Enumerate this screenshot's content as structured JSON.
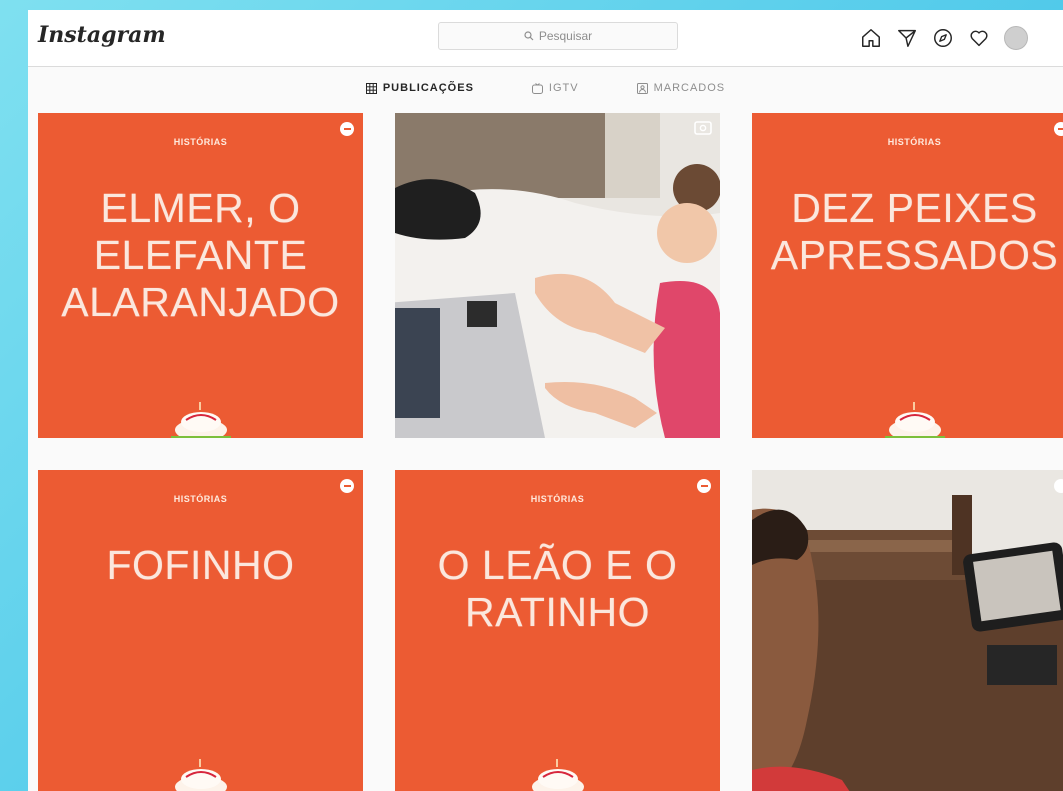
{
  "app": {
    "logo": "Instagram"
  },
  "search": {
    "placeholder": "Pesquisar"
  },
  "tabs": [
    {
      "label": "PUBLICAÇÕES",
      "icon": "grid-icon",
      "active": true
    },
    {
      "label": "IGTV",
      "icon": "igtv-icon",
      "active": false
    },
    {
      "label": "MARCADOS",
      "icon": "tagged-icon",
      "active": false
    }
  ],
  "posts": [
    {
      "kind": "story-card",
      "eyebrow": "HISTÓRIAS",
      "title": "ELMER, O\nELEFANTE\nALARANJADO"
    },
    {
      "kind": "photo",
      "icon": "video-icon"
    },
    {
      "kind": "story-card",
      "eyebrow": "HISTÓRIAS",
      "title": "DEZ PEIXES\nAPRESSADOS"
    },
    {
      "kind": "story-card",
      "eyebrow": "HISTÓRIAS",
      "title": "FOFINHO"
    },
    {
      "kind": "story-card",
      "eyebrow": "HISTÓRIAS",
      "title": "O LEÃO E O\nRATINHO"
    },
    {
      "kind": "photo",
      "icon": "carousel-icon"
    }
  ],
  "colors": {
    "card_orange": "#ec5b33",
    "card_text": "#fbe7dd",
    "frame_background": "#fafafa"
  }
}
